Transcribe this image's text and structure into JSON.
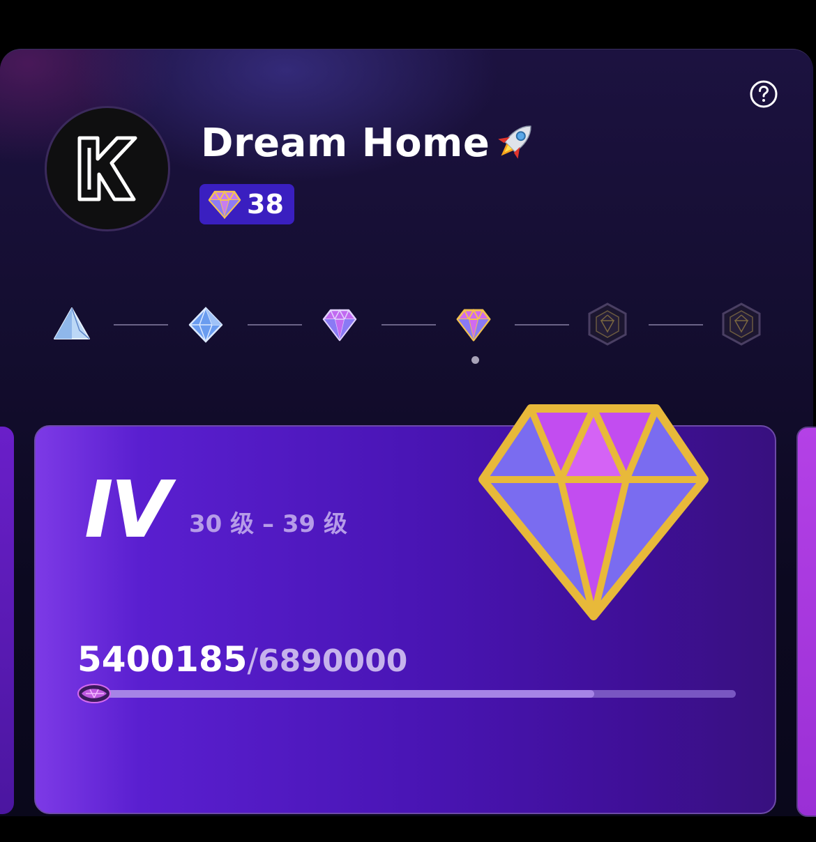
{
  "profile": {
    "name": "Dream Home",
    "rocket_emoji": "🚀",
    "avatar_letter": "K",
    "gem_count": "38"
  },
  "tiers": {
    "items": [
      {
        "icon": "triangle-crystal-icon",
        "state": "unlocked"
      },
      {
        "icon": "octahedron-crystal-icon",
        "state": "unlocked"
      },
      {
        "icon": "purple-diamond-icon",
        "state": "unlocked"
      },
      {
        "icon": "gold-diamond-icon",
        "state": "current"
      },
      {
        "icon": "locked-hexagon-icon",
        "state": "locked"
      },
      {
        "icon": "locked-hexagon-icon",
        "state": "locked"
      }
    ]
  },
  "level_card": {
    "roman": "IV",
    "range": "30 级 – 39 级",
    "score_current": "5400185",
    "score_separator": "/",
    "score_target": "6890000",
    "progress_fraction": 0.784
  },
  "colors": {
    "badge_bg": "#3a1fc0",
    "card_gradient_start": "#7d3ae6",
    "card_gradient_end": "#38107f",
    "gem_gold": "#e8b93a",
    "gem_purple": "#c24df0",
    "gem_blue": "#7a6cf0"
  }
}
